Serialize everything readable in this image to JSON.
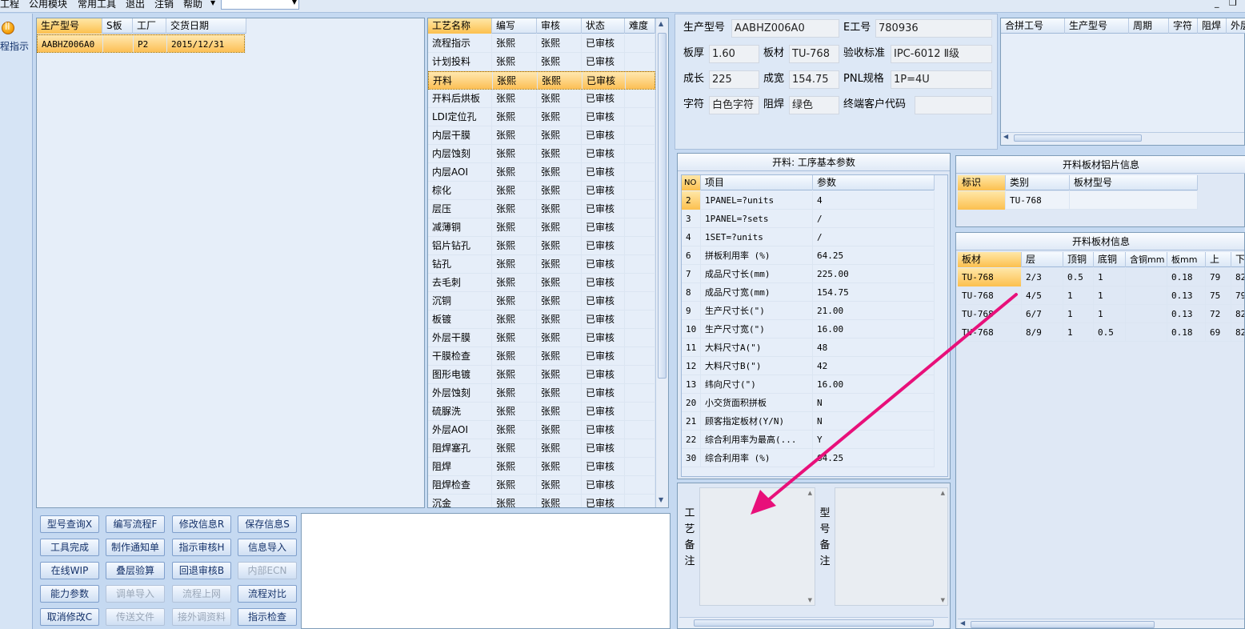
{
  "menu": {
    "items": [
      "工程",
      "公用模块",
      "常用工具",
      "退出",
      "注销",
      "帮助"
    ]
  },
  "left_strip": {
    "button_label": "程指示"
  },
  "order_grid": {
    "headers": [
      "生产型号",
      "S板",
      "工厂",
      "交货日期"
    ],
    "rows": [
      [
        "AABHZ006A0",
        "",
        "P2",
        "2015/12/31"
      ]
    ]
  },
  "process_grid": {
    "headers": [
      "工艺名称",
      "编写",
      "审核",
      "状态",
      "难度"
    ],
    "rows": [
      [
        "流程指示",
        "张熙",
        "张熙",
        "已审核"
      ],
      [
        "计划投料",
        "张熙",
        "张熙",
        "已审核"
      ],
      [
        "开料",
        "张熙",
        "张熙",
        "已审核"
      ],
      [
        "开料后烘板",
        "张熙",
        "张熙",
        "已审核"
      ],
      [
        "LDI定位孔",
        "张熙",
        "张熙",
        "已审核"
      ],
      [
        "内层干膜",
        "张熙",
        "张熙",
        "已审核"
      ],
      [
        "内层蚀刻",
        "张熙",
        "张熙",
        "已审核"
      ],
      [
        "内层AOI",
        "张熙",
        "张熙",
        "已审核"
      ],
      [
        "棕化",
        "张熙",
        "张熙",
        "已审核"
      ],
      [
        "层压",
        "张熙",
        "张熙",
        "已审核"
      ],
      [
        "减薄铜",
        "张熙",
        "张熙",
        "已审核"
      ],
      [
        "铝片钻孔",
        "张熙",
        "张熙",
        "已审核"
      ],
      [
        "钻孔",
        "张熙",
        "张熙",
        "已审核"
      ],
      [
        "去毛刺",
        "张熙",
        "张熙",
        "已审核"
      ],
      [
        "沉铜",
        "张熙",
        "张熙",
        "已审核"
      ],
      [
        "板镀",
        "张熙",
        "张熙",
        "已审核"
      ],
      [
        "外层干膜",
        "张熙",
        "张熙",
        "已审核"
      ],
      [
        "干膜检查",
        "张熙",
        "张熙",
        "已审核"
      ],
      [
        "图形电镀",
        "张熙",
        "张熙",
        "已审核"
      ],
      [
        "外层蚀刻",
        "张熙",
        "张熙",
        "已审核"
      ],
      [
        "硫脲洗",
        "张熙",
        "张熙",
        "已审核"
      ],
      [
        "外层AOI",
        "张熙",
        "张熙",
        "已审核"
      ],
      [
        "阻焊塞孔",
        "张熙",
        "张熙",
        "已审核"
      ],
      [
        "阻焊",
        "张熙",
        "张熙",
        "已审核"
      ],
      [
        "阻焊检查",
        "张熙",
        "张熙",
        "已审核"
      ],
      [
        "沉金",
        "张熙",
        "张熙",
        "已审核"
      ]
    ]
  },
  "buttons": [
    [
      "型号查询X",
      "编写流程F",
      "修改信息R",
      "保存信息S"
    ],
    [
      "工具完成",
      "制作通知单",
      "指示审核H",
      "信息导入"
    ],
    [
      "在线WIP",
      "叠层验算",
      "回退审核B",
      "内部ECN"
    ],
    [
      "能力参数",
      "调单导入",
      "流程上网",
      "流程对比"
    ],
    [
      "取消修改C",
      "传送文件",
      "接外调资料",
      "指示检查"
    ]
  ],
  "info": {
    "model_label": "生产型号",
    "model": "AABHZ006A0",
    "eno_label": "E工号",
    "eno": "780936",
    "thickness_label": "板厚",
    "thickness": "1.60",
    "material_label": "板材",
    "material": "TU-768",
    "standard_label": "验收标准",
    "standard": "IPC-6012 Ⅱ级",
    "length_label": "成长",
    "length": "225",
    "width_label": "成宽",
    "width": "154.75",
    "pnl_label": "PNL规格",
    "pnl": "1P=4U",
    "char_label": "字符",
    "char": "白色字符",
    "mask_label": "阻焊",
    "mask": "绿色",
    "customer_label": "终端客户代码",
    "customer": ""
  },
  "combine_grid": {
    "headers": [
      "合拼工号",
      "生产型号",
      "周期",
      "字符",
      "阻焊",
      "外层"
    ]
  },
  "params": {
    "title": "开料: 工序基本参数",
    "headers": [
      "NO",
      "项目",
      "参数"
    ],
    "rows": [
      [
        "2",
        "1PANEL=?units",
        "4"
      ],
      [
        "3",
        "1PANEL=?sets",
        "/"
      ],
      [
        "4",
        "1SET=?units",
        "/"
      ],
      [
        "6",
        "拼板利用率 (%)",
        "64.25"
      ],
      [
        "7",
        "成品尺寸长(mm)",
        "225.00"
      ],
      [
        "8",
        "成品尺寸宽(mm)",
        "154.75"
      ],
      [
        "9",
        "生产尺寸长(\")",
        "21.00"
      ],
      [
        "10",
        "生产尺寸宽(\")",
        "16.00"
      ],
      [
        "11",
        "大料尺寸A(\")",
        "48"
      ],
      [
        "12",
        "大料尺寸B(\")",
        "42"
      ],
      [
        "13",
        "纬向尺寸(\")",
        "16.00"
      ],
      [
        "20",
        "小交货面积拼板",
        "N"
      ],
      [
        "21",
        "顾客指定板材(Y/N)",
        "N"
      ],
      [
        "22",
        "综合利用率为最高(...",
        "Y"
      ],
      [
        "30",
        "综合利用率 (%)",
        "64.25"
      ]
    ]
  },
  "alu_info": {
    "title": "开料板材铝片信息",
    "headers": [
      "标识",
      "类别",
      "板材型号"
    ],
    "rows": [
      [
        "",
        "TU-768",
        ""
      ]
    ]
  },
  "material_info": {
    "title": "开料板材信息",
    "headers": [
      "板材",
      "层",
      "顶铜",
      "底铜",
      "含铜mm",
      "板mm",
      "上",
      "下"
    ],
    "rows": [
      [
        "TU-768",
        "2/3",
        "0.5",
        "1",
        "",
        "0.18",
        "79",
        "82"
      ],
      [
        "TU-768",
        "4/5",
        "1",
        "1",
        "",
        "0.13",
        "75",
        "79"
      ],
      [
        "TU-768",
        "6/7",
        "1",
        "1",
        "",
        "0.13",
        "72",
        "82"
      ],
      [
        "TU-768",
        "8/9",
        "1",
        "0.5",
        "",
        "0.18",
        "69",
        "82"
      ]
    ]
  },
  "remarks": {
    "process_label": "工艺备注",
    "model_label": "型号备注"
  },
  "annotation": {
    "arrow_color": "#e8107a"
  }
}
